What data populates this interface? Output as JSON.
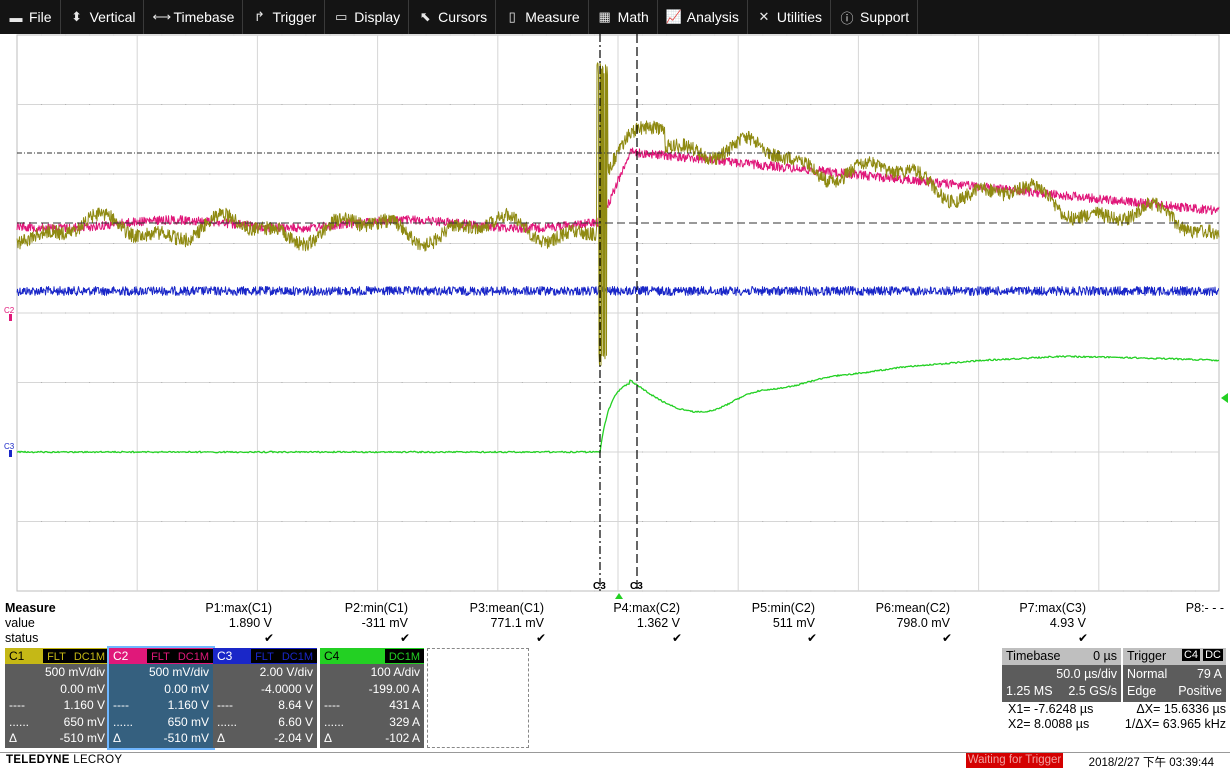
{
  "menu": [
    {
      "label": "File",
      "icon": "file-icon",
      "glyph": "▬"
    },
    {
      "label": "Vertical",
      "icon": "vertical-arrows-icon",
      "glyph": "⬍"
    },
    {
      "label": "Timebase",
      "icon": "horizontal-arrows-icon",
      "glyph": "⟷"
    },
    {
      "label": "Trigger",
      "icon": "trigger-edge-icon",
      "glyph": "↱"
    },
    {
      "label": "Display",
      "icon": "display-icon",
      "glyph": "▭"
    },
    {
      "label": "Cursors",
      "icon": "cursor-icon",
      "glyph": "⬉"
    },
    {
      "label": "Measure",
      "icon": "measure-icon",
      "glyph": "▯"
    },
    {
      "label": "Math",
      "icon": "math-grid-icon",
      "glyph": "▦"
    },
    {
      "label": "Analysis",
      "icon": "analysis-chart-icon",
      "glyph": "📈"
    },
    {
      "label": "Utilities",
      "icon": "wrench-icon",
      "glyph": "✕"
    },
    {
      "label": "Support",
      "icon": "info-icon",
      "glyph": "ⓘ"
    }
  ],
  "grid_markers": {
    "c2": "C2",
    "c3": "C3",
    "cursor_x1": "C3",
    "cursor_x2": "C3"
  },
  "measure": {
    "title": "Measure",
    "row_labels": {
      "value": "value",
      "status": "status"
    },
    "params": [
      {
        "name": "P1:max(C1)",
        "value": "1.890 V",
        "status": "✔"
      },
      {
        "name": "P2:min(C1)",
        "value": "-311 mV",
        "status": "✔"
      },
      {
        "name": "P3:mean(C1)",
        "value": "771.1 mV",
        "status": "✔"
      },
      {
        "name": "P4:max(C2)",
        "value": "1.362 V",
        "status": "✔"
      },
      {
        "name": "P5:min(C2)",
        "value": "511 mV",
        "status": "✔"
      },
      {
        "name": "P6:mean(C2)",
        "value": "798.0 mV",
        "status": "✔"
      },
      {
        "name": "P7:max(C3)",
        "value": "4.93 V",
        "status": "✔"
      },
      {
        "name": "P8:- - -",
        "value": "",
        "status": ""
      }
    ]
  },
  "channels": [
    {
      "id": "C1",
      "color": "#c5b816",
      "tags": [
        "FLT",
        "DC1M"
      ],
      "scale": "500 mV/div",
      "offset": "0.00 mV",
      "c1": "1.160 V",
      "c2": "650 mV",
      "delta": "-510 mV"
    },
    {
      "id": "C2",
      "color": "#e0187a",
      "tags": [
        "FLT",
        "DC1M"
      ],
      "scale": "500 mV/div",
      "offset": "0.00 mV",
      "c1": "1.160 V",
      "c2": "650 mV",
      "delta": "-510 mV"
    },
    {
      "id": "C3",
      "color": "#1a27c8",
      "tags": [
        "FLT",
        "DC1M"
      ],
      "scale": "2.00 V/div",
      "offset": "-4.0000 V",
      "c1": "8.64 V",
      "c2": "6.60 V",
      "delta": "-2.04 V"
    },
    {
      "id": "C4",
      "color": "#23d023",
      "tags": [
        "DC1M"
      ],
      "scale": "100 A/div",
      "offset": "-199.00 A",
      "c1": "431 A",
      "c2": "329 A",
      "delta": "-102 A"
    }
  ],
  "timebase": {
    "title": "Timebase",
    "delay": "0 µs",
    "per_div": "50.0 µs/div",
    "samples": "1.25 MS",
    "rate": "2.5 GS/s"
  },
  "trigger": {
    "title": "Trigger",
    "source": "C4",
    "coupling": "DC",
    "mode": "Normal",
    "level": "79 A",
    "type": "Edge",
    "slope": "Positive"
  },
  "cursors": {
    "x1": "X1=  -7.6248 µs",
    "dx": "ΔX=  15.6336 µs",
    "x2": "X2=   8.0088 µs",
    "inv_dx": "1/ΔX=  63.965 kHz"
  },
  "status": {
    "brand_bold": "TELEDYNE",
    "brand_light": "LECROY",
    "state": "Waiting for Trigger",
    "datetime": "2018/2/27 下午 03:39:44"
  }
}
